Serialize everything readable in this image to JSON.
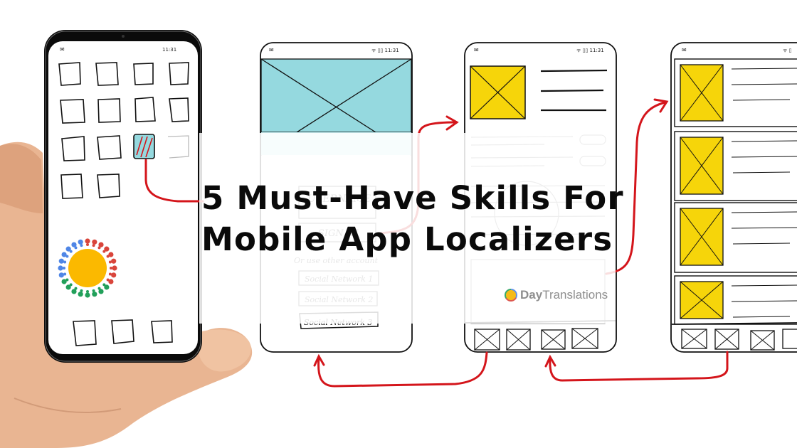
{
  "headline": {
    "line1": "5 Must-Have Skills For",
    "line2": "Mobile App Localizers"
  },
  "brand": {
    "bold": "Day",
    "regular": "Translations",
    "logo_icon": "sun-dots-logo-icon"
  },
  "wireframes": {
    "status_time": "11:31",
    "login_screen": {
      "username_label": "USERNAME",
      "signin_label": "SIGN IN",
      "alt_text": "Or use other account",
      "social_buttons": [
        "Social Network 1",
        "Social Network 2",
        "Social Network 3"
      ]
    }
  },
  "colors": {
    "accent_red": "#d4151b",
    "placeholder_yellow": "#f6d50a",
    "placeholder_cyan": "#95d9df",
    "logo_sun": "#fbb900",
    "logo_blue": "#4f86e6",
    "logo_red": "#d9453b",
    "logo_green": "#22a05a"
  }
}
